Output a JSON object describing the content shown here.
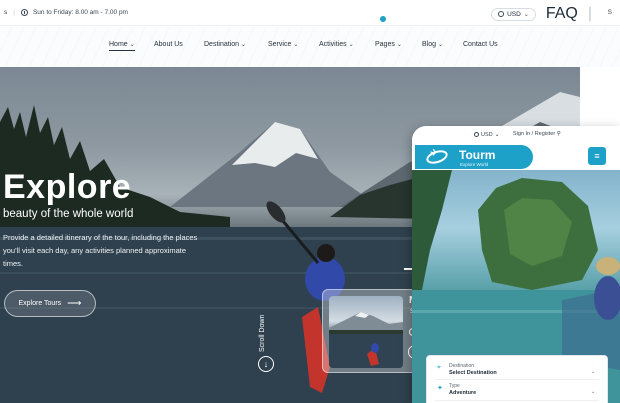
{
  "topbar": {
    "hours": "Sun to Friday: 8.00 am - 7.00 pm",
    "currency": "USD",
    "faq": "FAQ",
    "cut_label": "S"
  },
  "nav": {
    "items": [
      {
        "label": "Home",
        "dropdown": true,
        "active": true
      },
      {
        "label": "About Us",
        "dropdown": false
      },
      {
        "label": "Destination",
        "dropdown": true
      },
      {
        "label": "Service",
        "dropdown": true
      },
      {
        "label": "Activities",
        "dropdown": true
      },
      {
        "label": "Pages",
        "dropdown": true
      },
      {
        "label": "Blog",
        "dropdown": true
      },
      {
        "label": "Contact Us",
        "dropdown": false
      }
    ]
  },
  "hero": {
    "title": "Explore",
    "subtitle": "beauty of the whole world",
    "description": "Provide a detailed itinerary of the tour, including the places you'll visit each day, any activities planned approximate times.",
    "cta": "Explore Tours",
    "scroll_label": "Scroll Down",
    "card_letter": "M",
    "card_small": "S"
  },
  "phone": {
    "currency": "USD",
    "login": "Sign In / Register",
    "brand": "Tourm",
    "tagline": "Explore World",
    "search": {
      "destination_label": "Destination",
      "destination_value": "Select Destination",
      "type_label": "Type",
      "type_value": "Adventure"
    }
  },
  "icons": {
    "clock": "clock-icon",
    "globe": "globe-icon",
    "arrow": "arrow-right-icon",
    "scroll": "arrow-down-icon",
    "menu": "hamburger-menu-icon",
    "location": "location-pin-icon",
    "type": "type-icon",
    "user": "user-icon"
  },
  "colors": {
    "accent": "#1ea1c9",
    "text": "#1d2a38"
  }
}
